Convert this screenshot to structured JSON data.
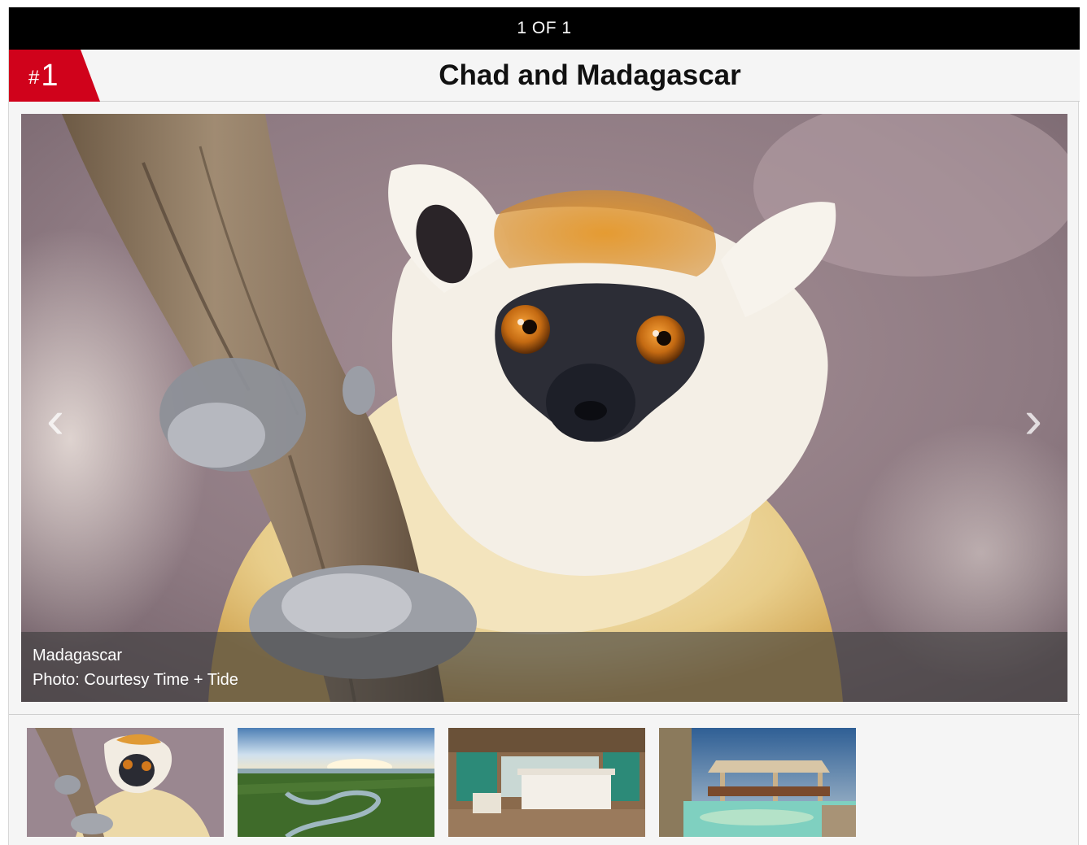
{
  "counter": "1 OF 1",
  "rank": {
    "hash": "#",
    "number": "1"
  },
  "title": "Chad and Madagascar",
  "slide": {
    "caption_line1": "Madagascar",
    "caption_line2": "Photo: Courtesy Time + Tide",
    "prev_arrow": "‹",
    "next_arrow": "›"
  },
  "colors": {
    "accent": "#d0021b",
    "bar": "#000000",
    "background": "#f5f5f5"
  },
  "thumbnails": [
    "lemur-thumbnail",
    "river-landscape-thumbnail",
    "lodge-bedroom-thumbnail",
    "pool-pavilion-thumbnail"
  ]
}
